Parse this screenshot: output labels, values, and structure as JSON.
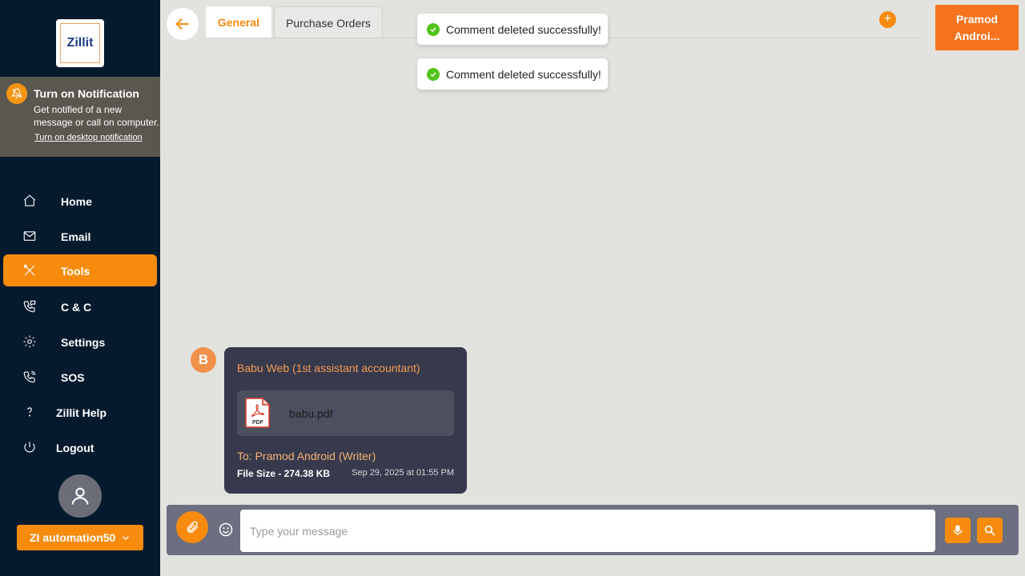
{
  "brand": {
    "logo_text": "Zillit",
    "accent": "#f68b0e",
    "sidebar_bg": "#061a2e"
  },
  "notification": {
    "title": "Turn on Notification",
    "text": "Get notified of a new message or call on computer.",
    "link": "Turn on desktop notification",
    "icon": "bell-off-icon"
  },
  "sidebar": {
    "items": [
      {
        "label": "Home",
        "icon": "home-icon",
        "active": false
      },
      {
        "label": "Email",
        "icon": "mail-icon",
        "active": false
      },
      {
        "label": "Tools",
        "icon": "tools-icon",
        "active": true
      },
      {
        "label": "C & C",
        "icon": "phone-chat-icon",
        "active": false
      },
      {
        "label": "Settings",
        "icon": "gear-icon",
        "active": false
      },
      {
        "label": "SOS",
        "icon": "sos-phone-icon",
        "active": false
      },
      {
        "label": "Zillit Help",
        "icon": "question-icon",
        "active": false
      },
      {
        "label": "Logout",
        "icon": "power-icon",
        "active": false
      }
    ],
    "user": {
      "name": "ZI automation50",
      "icon": "user-icon"
    }
  },
  "header": {
    "tabs": [
      {
        "label": "General",
        "active": true
      },
      {
        "label": "Purchase Orders",
        "active": false
      }
    ],
    "profile_button": {
      "line1": "Pramod",
      "line2": "Androi..."
    }
  },
  "toasts": [
    {
      "text": "Comment deleted successfully!"
    },
    {
      "text": "Comment deleted successfully!"
    }
  ],
  "message": {
    "avatar_letter": "B",
    "sender": "Babu Web (1st assistant accountant)",
    "attachment": {
      "filename": "babu.pdf",
      "type_label": "PDF"
    },
    "to": "To: Pramod Android (Writer)",
    "file_size": "File Size - 274.38 KB",
    "timestamp": "Sep 29, 2025 at 01:55 PM"
  },
  "composer": {
    "placeholder": "Type your message"
  }
}
